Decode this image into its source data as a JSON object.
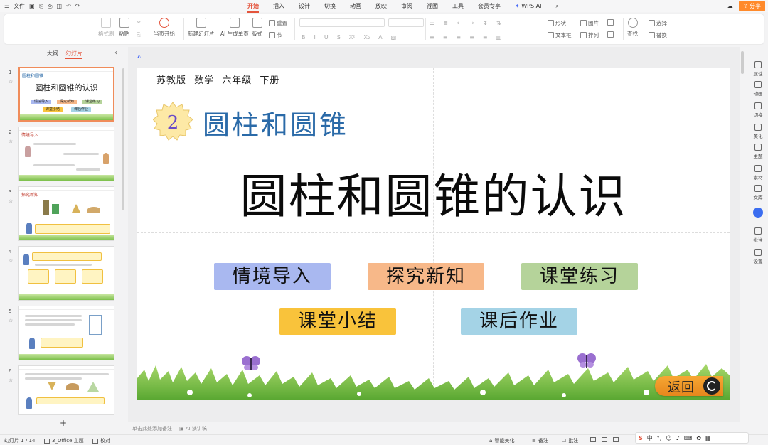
{
  "menubar": {
    "file_label": "文件",
    "tabs": [
      "开始",
      "插入",
      "设计",
      "切换",
      "动画",
      "放映",
      "审阅",
      "视图",
      "工具",
      "会员专享"
    ],
    "active_tab": "开始",
    "wps_ai_label": "WPS AI",
    "share_label": "分享"
  },
  "ribbon": {
    "format_painter": "格式刷",
    "paste": "粘贴",
    "play_from_current": "当页开始",
    "new_slide": "新建幻灯片",
    "ai_generate": "AI 生成单页",
    "layout": "版式",
    "section": "节",
    "reset": "重置",
    "shape": "形状",
    "picture": "图片",
    "textbox": "文本框",
    "arrange": "排列",
    "select": "选择",
    "find": "查找",
    "replace": "替换"
  },
  "left_panel": {
    "tab_outline": "大纲",
    "tab_slides": "幻灯片",
    "active_tab": "幻灯片",
    "thumbnails": [
      {
        "num": "1",
        "label": "圆柱和圆锥",
        "title": "圆柱和圆锥的认识",
        "chips": [
          "情境导入",
          "探究新知",
          "课堂练习",
          "课堂小结",
          "课后作业"
        ]
      },
      {
        "num": "2",
        "label": "情境导入"
      },
      {
        "num": "3",
        "label": "探究新知"
      },
      {
        "num": "4",
        "label": ""
      },
      {
        "num": "5",
        "label": ""
      },
      {
        "num": "6",
        "label": ""
      }
    ]
  },
  "slide": {
    "edition": "苏教版 数学 六年级 下册",
    "chapter_number": "2",
    "chapter_title": "圆柱和圆锥",
    "main_title": "圆柱和圆锥的认识",
    "nav_buttons": [
      {
        "label": "情境导入",
        "color": "#a9b8f0"
      },
      {
        "label": "探究新知",
        "color": "#f7b889"
      },
      {
        "label": "课堂练习",
        "color": "#b5d39a"
      },
      {
        "label": "课堂小结",
        "color": "#f9c33b"
      },
      {
        "label": "课后作业",
        "color": "#a4d3e6"
      }
    ],
    "return_label": "返回"
  },
  "right_panel": {
    "items": [
      "属性",
      "动画",
      "切换",
      "美化",
      "主题",
      "素材",
      "文库",
      "批注",
      "设置"
    ]
  },
  "notes": {
    "placeholder": "单击此处添加备注",
    "ai_notes": "AI 演讲稿"
  },
  "status": {
    "slide_counter": "幻灯片 1 / 14",
    "theme": "3_Office 主题",
    "proofread": "校对",
    "smart_beautify": "智能美化",
    "notes": "备注",
    "comments": "批注"
  },
  "ime": {
    "logo": "S",
    "mode": "中"
  }
}
